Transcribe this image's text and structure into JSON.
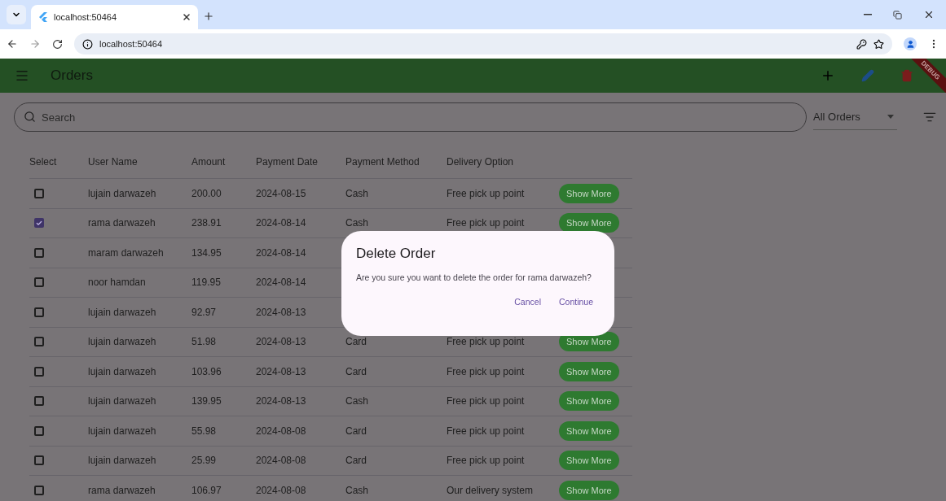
{
  "browser": {
    "tab_title": "localhost:50464",
    "url": "localhost:50464"
  },
  "app_bar": {
    "title": "Orders",
    "debug_banner": "DEBUG"
  },
  "search": {
    "placeholder": "Search"
  },
  "filter": {
    "value": "All Orders"
  },
  "table": {
    "columns": [
      "Select",
      "User Name",
      "Amount",
      "Payment Date",
      "Payment Method",
      "Delivery Option"
    ],
    "rows": [
      {
        "selected": false,
        "user": "lujain darwazeh",
        "amount": "200.00",
        "date": "2024-08-15",
        "method": "Cash",
        "delivery": "Free pick up point",
        "action": "Show More"
      },
      {
        "selected": true,
        "user": "rama darwazeh",
        "amount": "238.91",
        "date": "2024-08-14",
        "method": "Cash",
        "delivery": "Free pick up point",
        "action": "Show More"
      },
      {
        "selected": false,
        "user": "maram darwazeh",
        "amount": "134.95",
        "date": "2024-08-14"
      },
      {
        "selected": false,
        "user": "noor hamdan",
        "amount": "119.95",
        "date": "2024-08-14"
      },
      {
        "selected": false,
        "user": "lujain darwazeh",
        "amount": "92.97",
        "date": "2024-08-13"
      },
      {
        "selected": false,
        "user": "lujain darwazeh",
        "amount": "51.98",
        "date": "2024-08-13",
        "method": "Card",
        "delivery": "Free pick up point",
        "action": "Show More"
      },
      {
        "selected": false,
        "user": "lujain darwazeh",
        "amount": "103.96",
        "date": "2024-08-13",
        "method": "Card",
        "delivery": "Free pick up point",
        "action": "Show More"
      },
      {
        "selected": false,
        "user": "lujain darwazeh",
        "amount": "139.95",
        "date": "2024-08-13",
        "method": "Cash",
        "delivery": "Free pick up point",
        "action": "Show More"
      },
      {
        "selected": false,
        "user": "lujain darwazeh",
        "amount": "55.98",
        "date": "2024-08-08",
        "method": "Card",
        "delivery": "Free pick up point",
        "action": "Show More"
      },
      {
        "selected": false,
        "user": "lujain darwazeh",
        "amount": "25.99",
        "date": "2024-08-08",
        "method": "Card",
        "delivery": "Free pick up point",
        "action": "Show More"
      },
      {
        "selected": false,
        "user": "rama darwazeh",
        "amount": "106.97",
        "date": "2024-08-08",
        "method": "Cash",
        "delivery": "Our delivery system",
        "action": "Show More"
      }
    ]
  },
  "dialog": {
    "title": "Delete Order",
    "message": "Are you sure you want to delete the order for rama darwazeh?",
    "buttons": [
      "Cancel",
      "Continue"
    ]
  }
}
